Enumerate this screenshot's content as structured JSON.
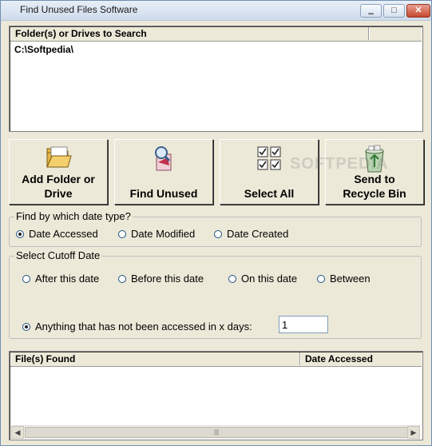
{
  "window": {
    "title": "Find Unused Files Software",
    "minimize": "▭",
    "maximize": "□",
    "close": "✕"
  },
  "folders": {
    "header": "Folder(s) or Drives to Search",
    "items": [
      "C:\\Softpedia\\"
    ]
  },
  "buttons": {
    "add_folder": "Add Folder or Drive",
    "find_unused": "Find Unused",
    "select_all": "Select All",
    "send_to_recycle": "Send to Recycle Bin"
  },
  "date_type": {
    "legend": "Find by which date type?",
    "options": [
      "Date Accessed",
      "Date Modified",
      "Date Created"
    ],
    "selected": "Date Accessed"
  },
  "cutoff": {
    "legend": "Select Cutoff Date",
    "options": [
      "After this date",
      "Before this date",
      "On this date",
      "Between"
    ],
    "days_option": "Anything that has not been accessed in x days:",
    "days_value": "1",
    "selected": "Anything that has not been accessed in x days:"
  },
  "results": {
    "columns": [
      "File(s) Found",
      "Date Accessed"
    ],
    "rows": []
  },
  "watermark": "SOFTPEDIA"
}
